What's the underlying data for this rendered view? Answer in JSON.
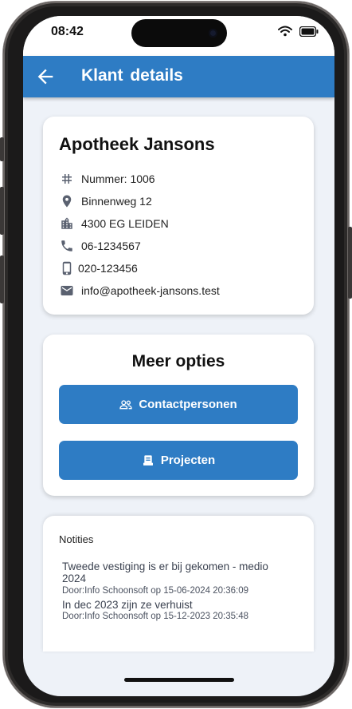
{
  "status_bar": {
    "time": "08:42"
  },
  "app_bar": {
    "title": "Klant  details"
  },
  "customer": {
    "name": "Apotheek Jansons",
    "number": "Nummer: 1006",
    "address": "Binnenweg 12",
    "postal_city": "4300 EG LEIDEN",
    "phone": "06-1234567",
    "mobile": "020-123456",
    "email": "info@apotheek-jansons.test"
  },
  "options": {
    "title": "Meer opties",
    "contacts_label": "Contactpersonen",
    "projects_label": "Projecten"
  },
  "notes": {
    "heading": "Notities",
    "items": [
      {
        "text": "Tweede vestiging is er bij gekomen - medio 2024",
        "meta": "Door:Info Schoonsoft op 15-06-2024 20:36:09"
      },
      {
        "text": "In dec 2023 zijn ze verhuist",
        "meta": "Door:Info Schoonsoft op 15-12-2023 20:35:48"
      }
    ]
  },
  "colors": {
    "primary": "#2e7cc4",
    "background": "#eef2f8",
    "icon": "#5a6170"
  }
}
